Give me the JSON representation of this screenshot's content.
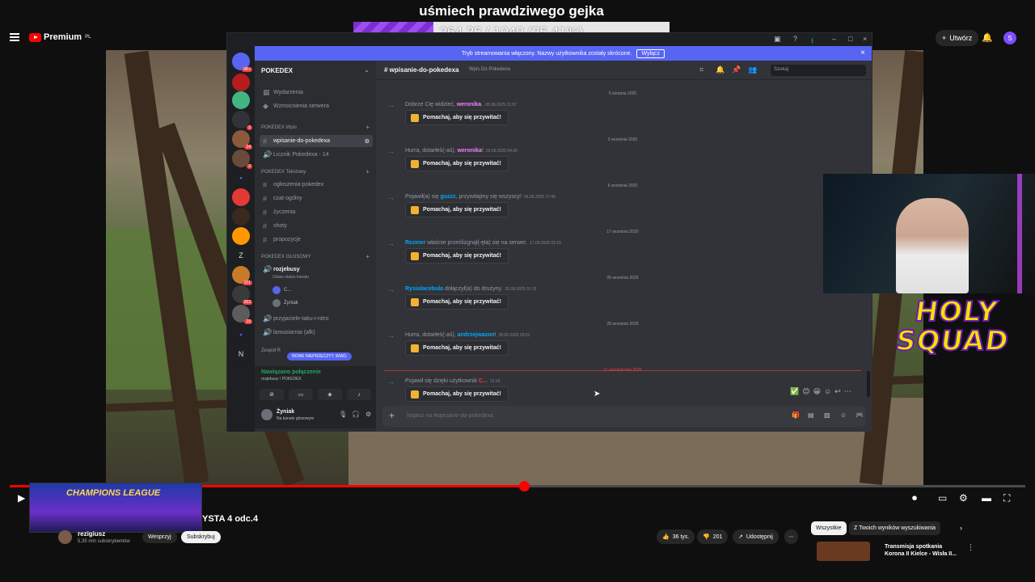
{
  "overlay": {
    "title": "uśmiech prawdziwego gejka",
    "progress_text": "264.25 / 1040 (25.41%)",
    "progress_fraction": 0.2541
  },
  "youtube": {
    "logo": "Premium",
    "logo_region": "PL",
    "create_label": "Utwórz",
    "avatar_letter": "S"
  },
  "discord": {
    "banner_text": "Tryb streamowania włączony. Nazwy użytkownika zostały skrócone.",
    "banner_button": "Wyłącz",
    "guild": "POKEDEX",
    "top_items": [
      "Wydarzenia",
      "Wzmocnienia serwera"
    ],
    "categories": {
      "wpis": "POKEDEX Wpis",
      "tekstowy": "POKEDEX Tekstowy",
      "glosowy": "POKEDEX GŁOSOWY",
      "zespol": "Zespół R"
    },
    "wpis_channels": [
      "wpisanie-do-pokedexa",
      "Licznik Pokedexa - 14"
    ],
    "text_channels": [
      "ogłoszenia-pokedex",
      "czat-ogólny",
      "życzenia",
      "shoty",
      "propozycje"
    ],
    "voice_channel": "rozjebusy",
    "voice_channel_status": "Ustaw status kanału",
    "voice_users": [
      "C...",
      "Żyniak"
    ],
    "voice_channels_more": [
      "przyjaciele-taku-i-nitro",
      "lamusiarnia (afk)"
    ],
    "new_unread": "NOWE NIEPRZECZYT. WIAD.",
    "voice_connected": "Nawiązano połączenie",
    "voice_connected_sub": "rozjebusy / POKEDEX",
    "user_name": "Żyniak",
    "user_status": "Na kanale głosowym",
    "channel_name": "wpisanie-do-pokedexa",
    "channel_topic": "Wpis Do Pokedexa",
    "search_placeholder": "Szukaj",
    "composer_placeholder": "Napisz na #wpisanie-do-pokedexa",
    "wave_label": "Pomachaj, aby się przywitać!",
    "dates": [
      "5 sierpnia 2025",
      "3 września 2025",
      "6 września 2025",
      "17 września 2025",
      "26 września 2025",
      "28 września 2025",
      "11 października 2025"
    ],
    "messages": [
      {
        "pre": "Dobrze Cię widzieć, ",
        "user": "weronika",
        "post": ".",
        "time": "05.08.2025 21:57",
        "color": "#f47fff"
      },
      {
        "pre": "Hurra, dotarłeś(-aś), ",
        "user": "weronika",
        "post": "!",
        "time": "03.09.2025 04:26",
        "color": "#f47fff"
      },
      {
        "pre": "Pojawił(a) się ",
        "user": "guzzz",
        "post": ", przywitajmy się wszyscy!",
        "time": "06.09.2025 17:46",
        "color": "#00a8fc"
      },
      {
        "pre": "",
        "user": "Reziner",
        "post": " właśnie prześlizgnął(-ęła) się na serwer.",
        "time": "17.09.2025 03:10",
        "color": "#00a8fc"
      },
      {
        "pre": "",
        "user": "Rysiulacebula",
        "post": " dołączył(a) do drużyny.",
        "time": "26.09.2025 01:15",
        "color": "#00a8fc"
      },
      {
        "pre": "Hurra, dotarłeś(-aś), ",
        "user": "andrzejwazon",
        "post": "!",
        "time": "28.09.2025 20:01",
        "color": "#00a8fc"
      },
      {
        "pre": "Pojawił się dzięki użytkownik ",
        "user": "C...",
        "post": "",
        "time": "21:19",
        "color": "#f23f42"
      }
    ],
    "server_badges": [
      "9K+",
      "2",
      "14",
      "2",
      "101",
      "263",
      "19"
    ]
  },
  "video": {
    "title": "YSTA 4 odc.4",
    "thumb_text": "CHAMPIONS LEAGUE",
    "channel": "rezigiusz",
    "subscribers": "5,35 mln subskrybentów",
    "support_label": "Wesprzyj",
    "subscribe_label": "Subskrybuj",
    "likes": "36 tys.",
    "dislikes": "201",
    "share_label": "Udostępnij",
    "played_fraction": 0.506
  },
  "sidebar": {
    "chips": [
      "Wszystkie",
      "Z Twoich wyników wyszukiwania"
    ],
    "rec_title_1": "Transmisja spotkania",
    "rec_title_2": "Korona II Kielce - Wisła II..."
  },
  "webcam": {
    "logo_line_1": "HOLY",
    "logo_line_2": "SQUAD"
  }
}
